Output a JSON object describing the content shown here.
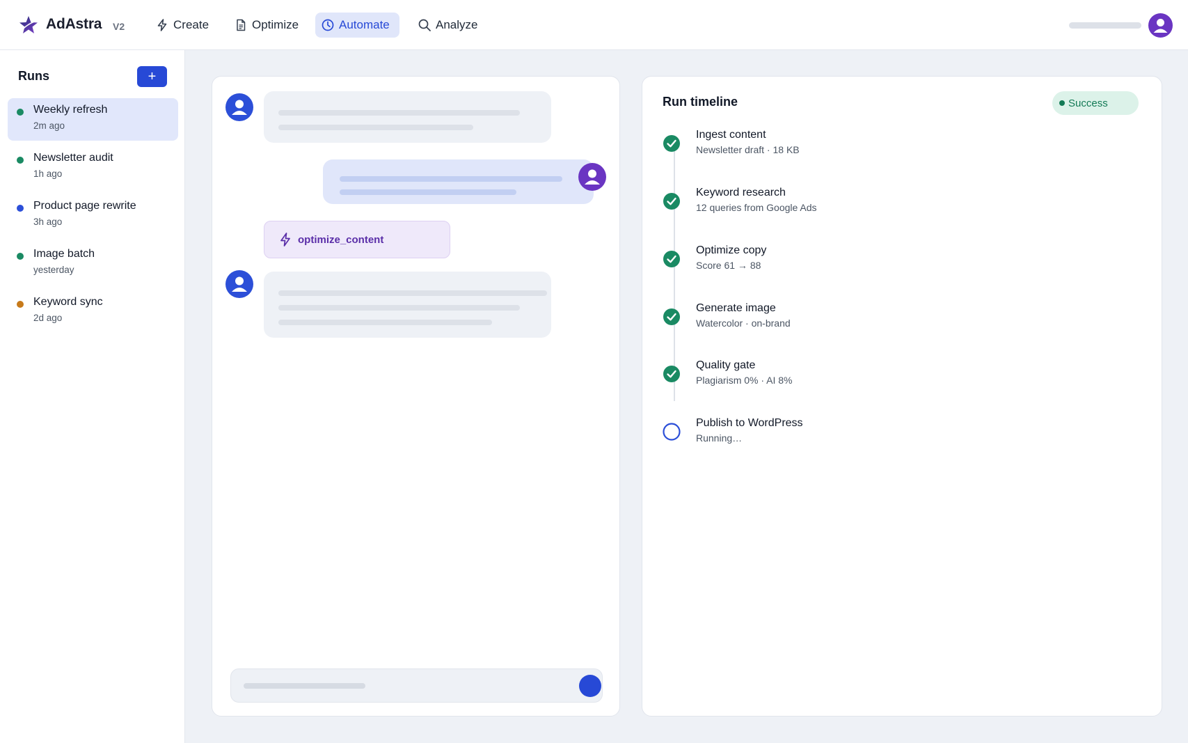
{
  "app": {
    "brand": "AdAstra",
    "version": "V2",
    "colors": {
      "accent": "#2749d6",
      "active_bg": "#e0e6fa",
      "avatar_purple": "#6a35c2",
      "success_green": "#137a55"
    }
  },
  "nav": [
    {
      "label": "Create",
      "icon": "bolt-icon",
      "active": false
    },
    {
      "label": "Optimize",
      "icon": "document-icon",
      "active": false
    },
    {
      "label": "Automate",
      "icon": "clock-icon",
      "active": true
    },
    {
      "label": "Analyze",
      "icon": "search-icon",
      "active": false
    }
  ],
  "header": {
    "avatar_icon": "user-icon"
  },
  "sidebar": {
    "title": "Runs",
    "add_label": "+",
    "runs": [
      {
        "name": "Weekly refresh",
        "time": "2m ago",
        "status_color": "#1a8a63",
        "selected": true
      },
      {
        "name": "Newsletter audit",
        "time": "1h ago",
        "status_color": "#1a8a63",
        "selected": false
      },
      {
        "name": "Product page rewrite",
        "time": "3h ago",
        "status_color": "#2c4fd8",
        "selected": false
      },
      {
        "name": "Image batch",
        "time": "yesterday",
        "status_color": "#1a8a63",
        "selected": false
      },
      {
        "name": "Keyword sync",
        "time": "2d ago",
        "status_color": "#c77a1a",
        "selected": false
      }
    ]
  },
  "chat": {
    "tool_call": {
      "label": "optimize_content",
      "icon": "bolt-icon"
    }
  },
  "timeline": {
    "title": "Run timeline",
    "status": "Success",
    "steps": [
      {
        "title": "Ingest content",
        "subtitle": "Newsletter draft · 18 KB",
        "state": "done"
      },
      {
        "title": "Keyword research",
        "subtitle": "12 queries from Google Ads",
        "state": "done"
      },
      {
        "title": "Optimize copy",
        "subtitle": "Score 61 → 88",
        "state": "done"
      },
      {
        "title": "Generate image",
        "subtitle": "Watercolor · on-brand",
        "state": "done"
      },
      {
        "title": "Quality gate",
        "subtitle": "Plagiarism 0% · AI 8%",
        "state": "done"
      },
      {
        "title": "Publish to WordPress",
        "subtitle": "Running…",
        "state": "running"
      }
    ]
  }
}
